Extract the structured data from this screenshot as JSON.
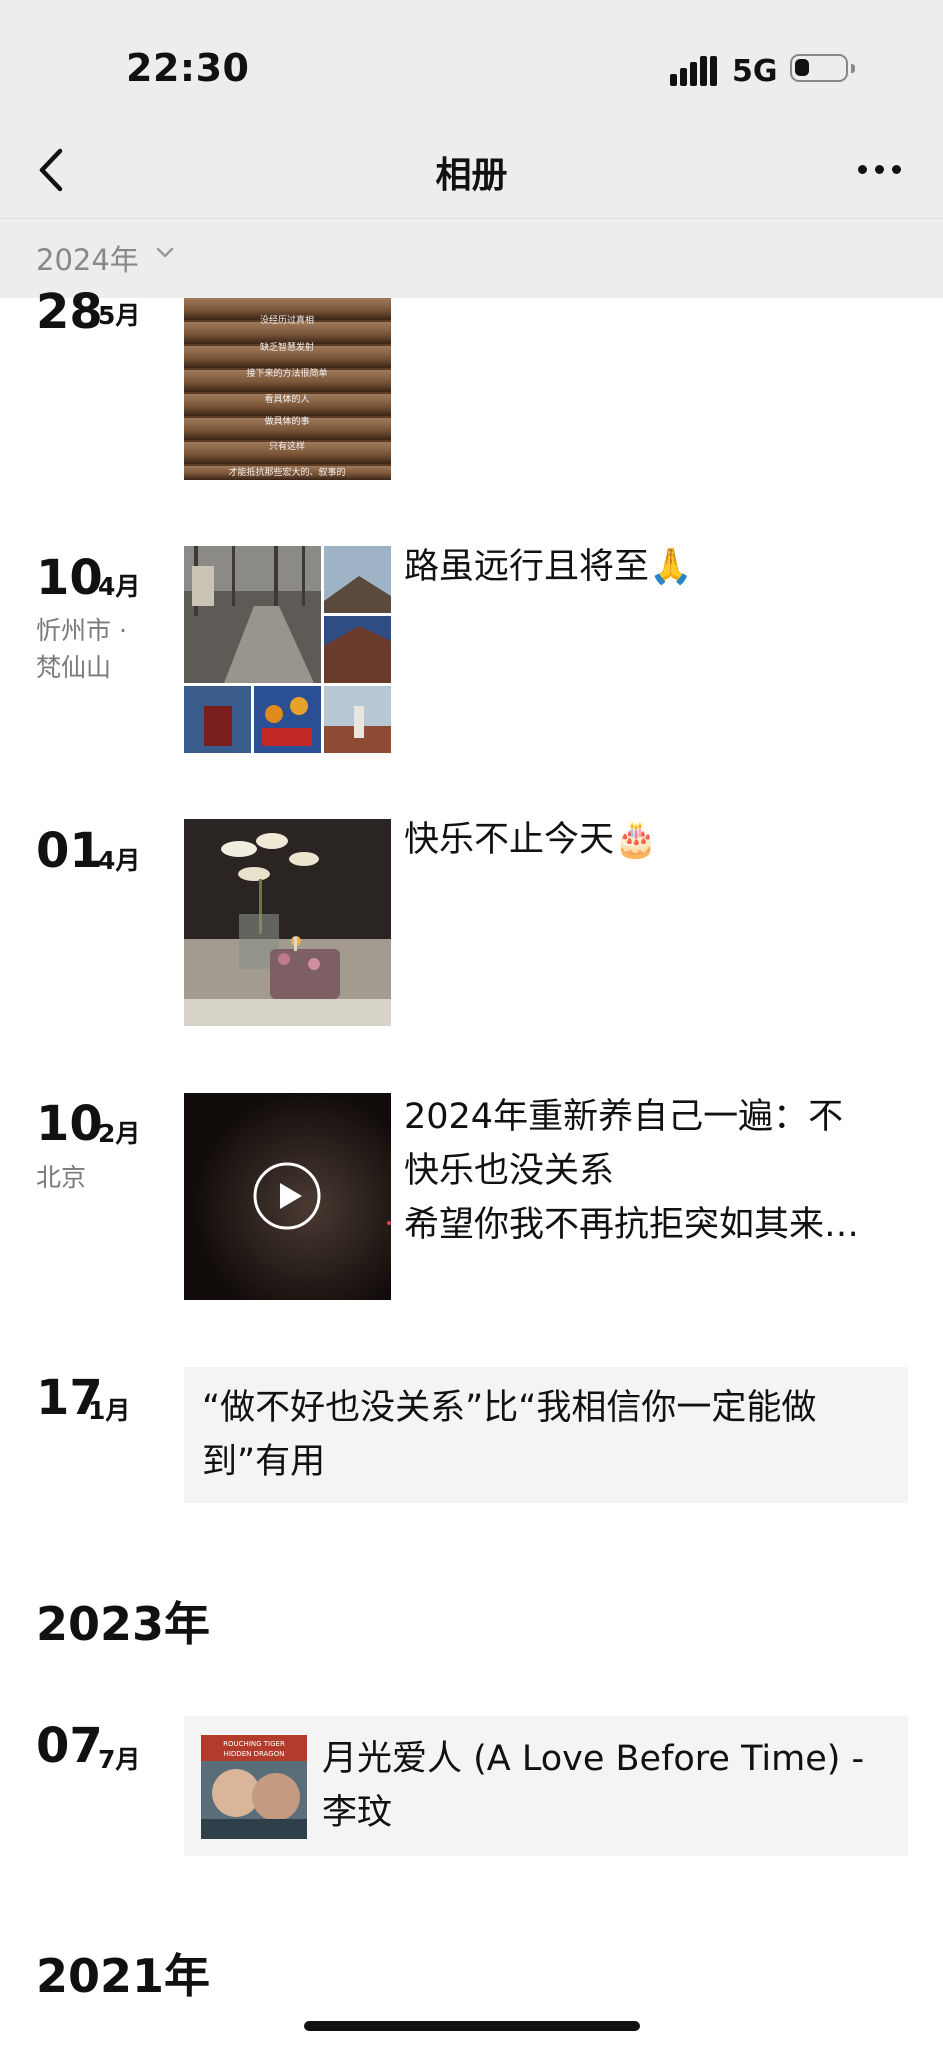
{
  "status_bar": {
    "time": "22:30",
    "network": "5G"
  },
  "nav": {
    "title": "相册",
    "back_icon": "chevron-left-icon",
    "more_icon": "more-icon"
  },
  "year_filter": {
    "label": "2024年"
  },
  "posts": [
    {
      "day": "28",
      "month": "5月",
      "location": "",
      "text": "",
      "image_lines": [
        "没经历过真相",
        "缺乏智慧发射",
        "接下来的方法很简单",
        "看具体的人",
        "做具体的事",
        "只有这样",
        "才能抵抗那些宏大的、叙事的"
      ]
    },
    {
      "day": "10",
      "month": "4月",
      "location_line1": "忻州市 ·",
      "location_line2": "梵仙山",
      "text": "路虽远行且将至🙏"
    },
    {
      "day": "01",
      "month": "4月",
      "text": "快乐不止今天🎂"
    },
    {
      "day": "10",
      "month": "2月",
      "location": "北京",
      "text_line1": "2024年重新养自己一遍：不",
      "text_line2": "快乐也没关系",
      "text_line3": "希望你我不再抗拒突如其来…"
    },
    {
      "day": "17",
      "month": "1月",
      "text_line1": "“做不好也没关系”比“我相信你一定能做",
      "text_line2": "到”有用"
    }
  ],
  "year_2023": "2023年",
  "music_post": {
    "day": "07",
    "month": "7月",
    "title_line1": "月光爱人 (A Love Before Time) -",
    "title_line2": "李玟",
    "cover_text_1": "ROUCHING TIGER",
    "cover_text_2": "HIDDEN DRAGON"
  },
  "year_2021": "2021年"
}
